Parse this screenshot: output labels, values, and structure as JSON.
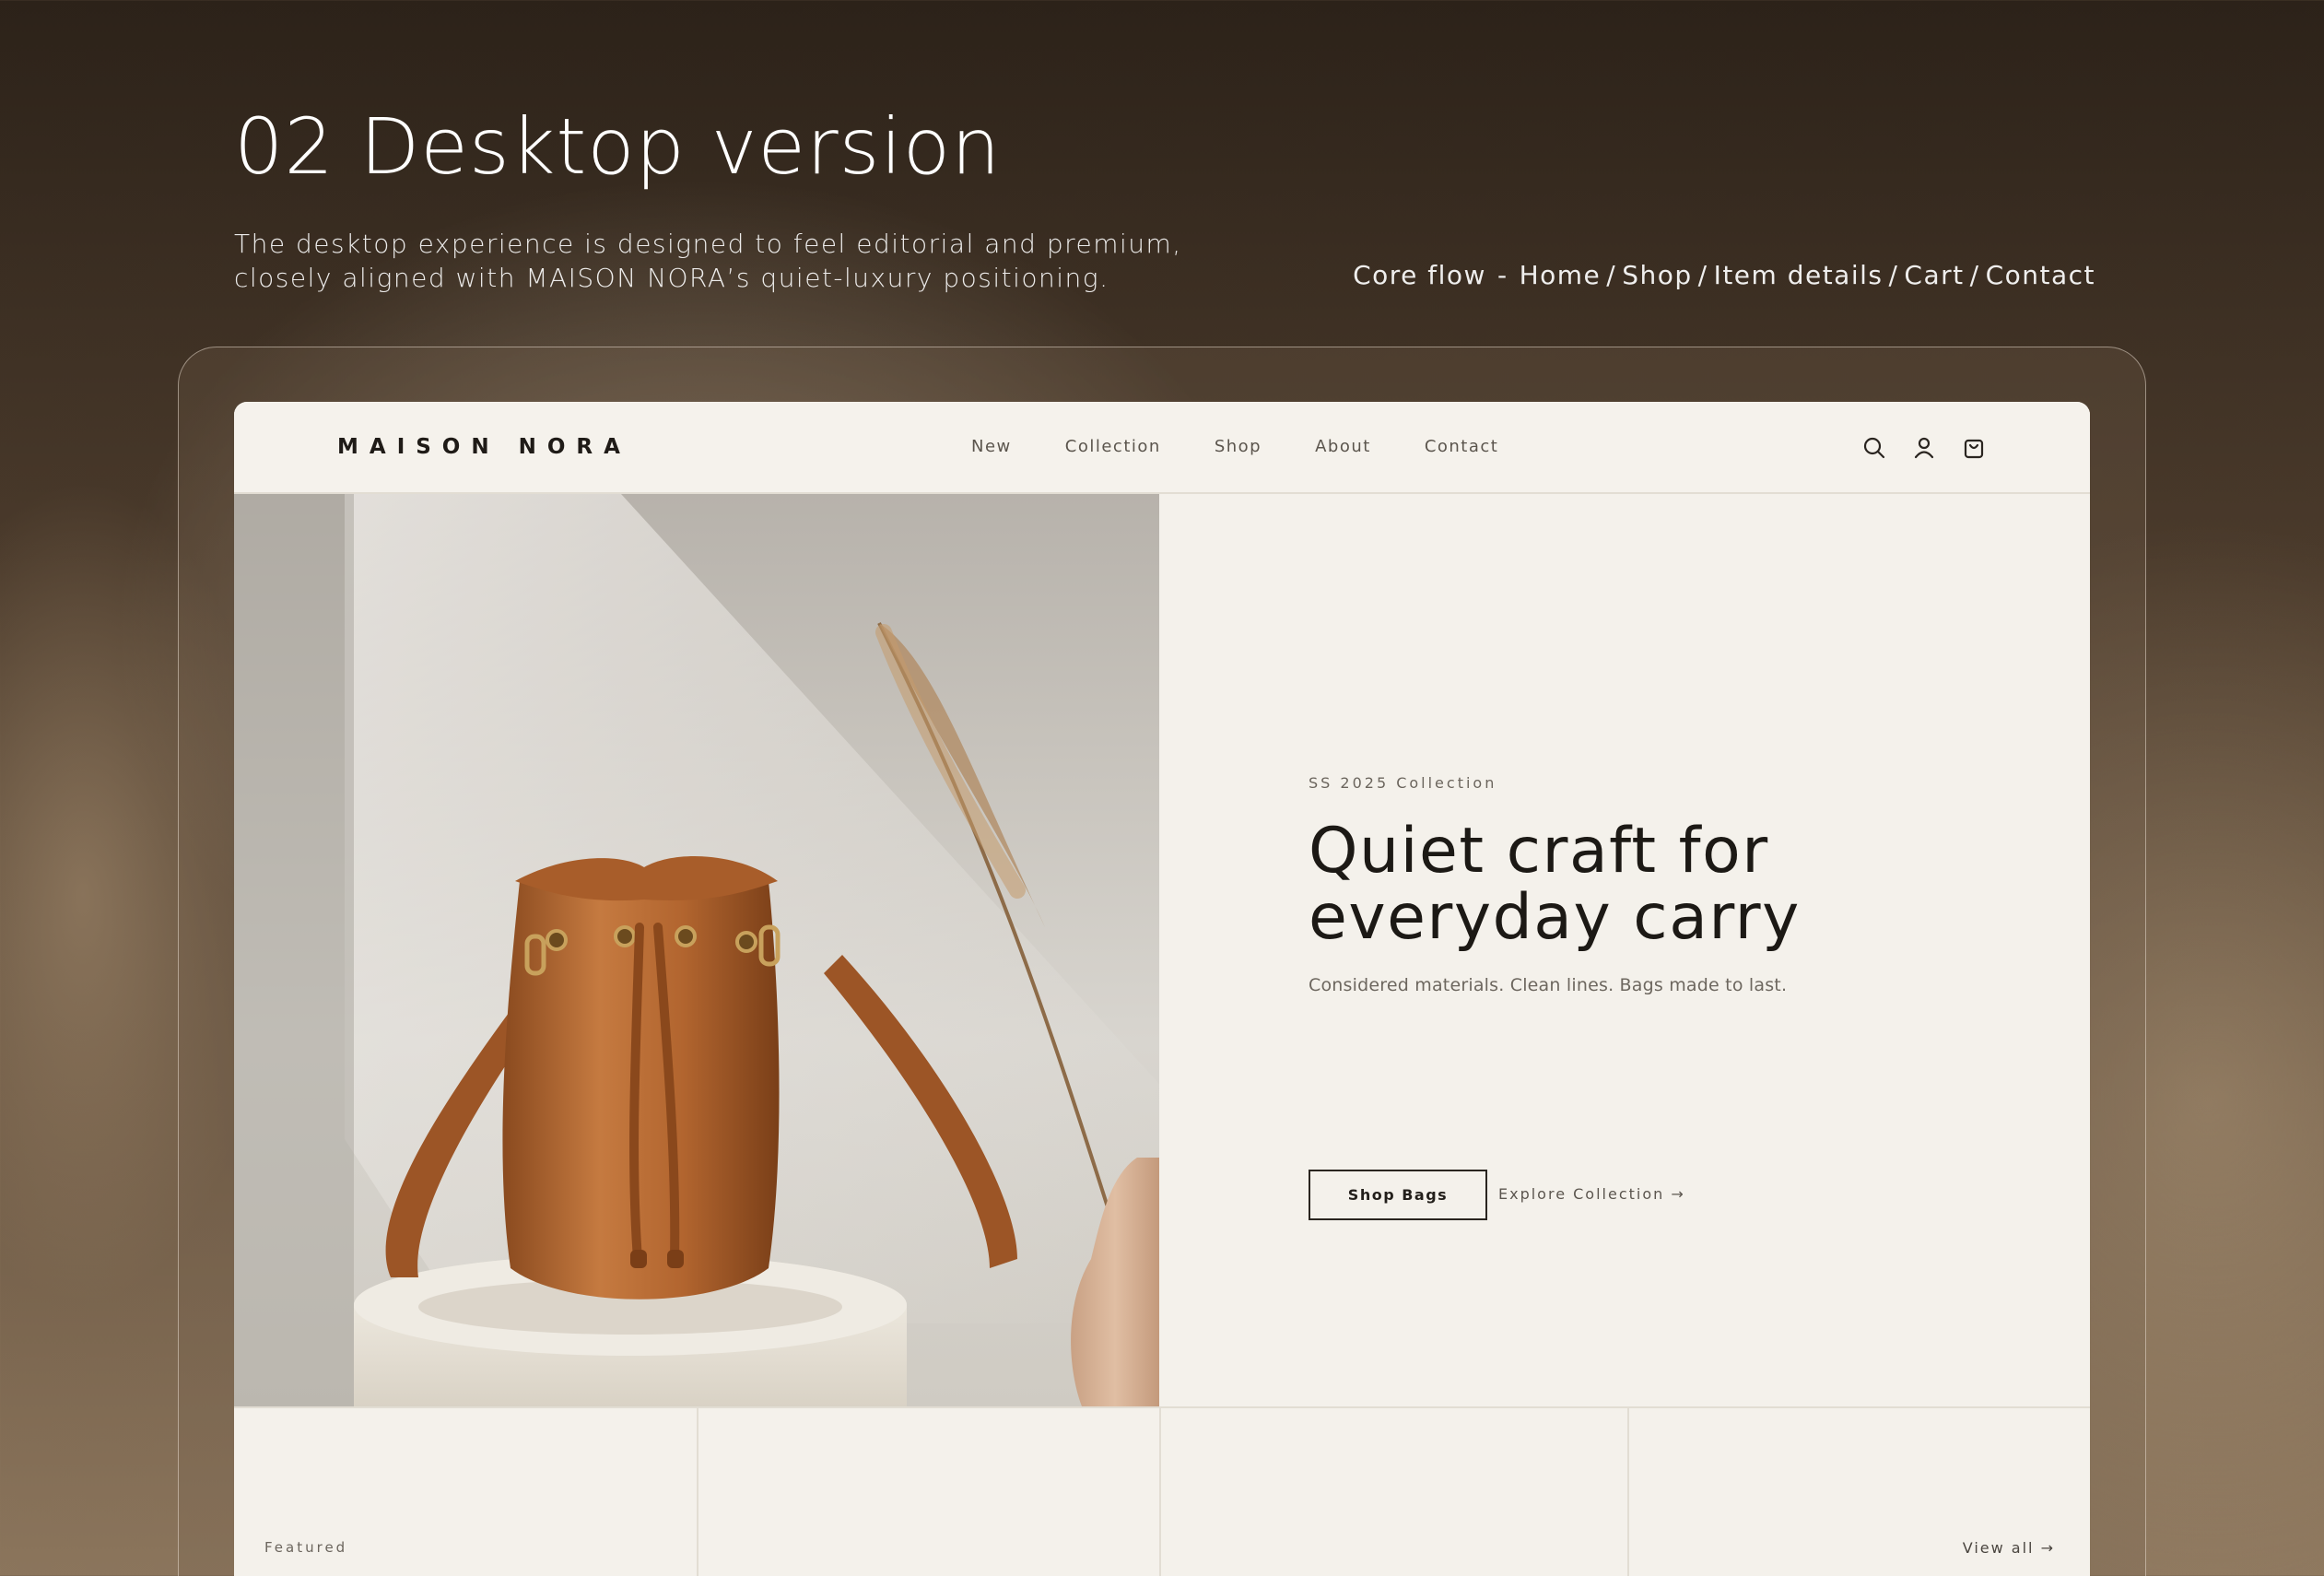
{
  "page": {
    "heading": "02 Desktop version",
    "description_lines": [
      "The desktop experience is designed to feel editorial and premium,",
      "closely aligned with MAISON NORA’s quiet-luxury positioning."
    ],
    "core_flow": {
      "label": "Core flow",
      "separator": "-",
      "crumbs": [
        "Home",
        "Shop",
        "Item details",
        "Cart",
        "Contact"
      ]
    }
  },
  "site": {
    "logo": "MAISON NORA",
    "nav": [
      "New",
      "Collection",
      "Shop",
      "About",
      "Contact"
    ],
    "icons": [
      "search-icon",
      "user-icon",
      "shopping-bag-icon"
    ],
    "hero": {
      "eyebrow": "SS 2025 Collection",
      "title_lines": [
        "Quiet craft for",
        "everyday carry"
      ],
      "subtitle": "Considered materials. Clean lines. Bags made to last.",
      "primary_cta": "Shop Bags",
      "secondary_cta": "Explore Collection →"
    },
    "featured": {
      "label": "Featured",
      "view_all": "View all →"
    }
  },
  "colors": {
    "background_dark": "#2c2219",
    "site_bg": "#f4f1eb",
    "text_dark": "#1c1915",
    "bag_tan": "#b2652f"
  }
}
